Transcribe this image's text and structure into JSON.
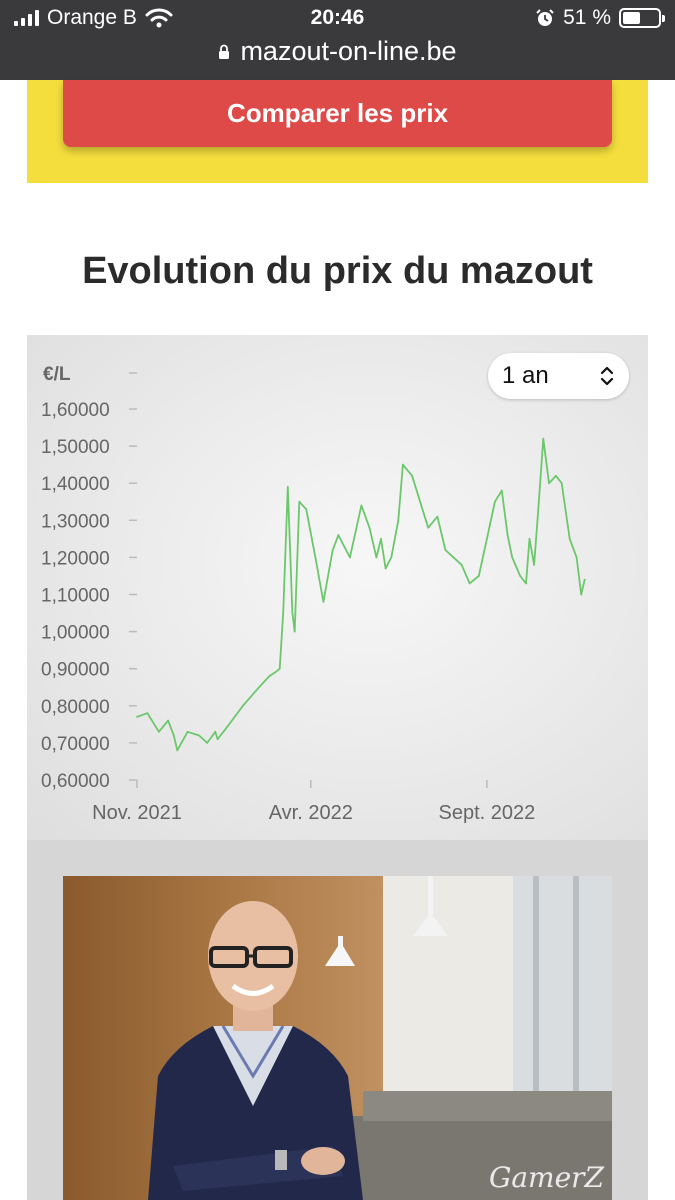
{
  "status_bar": {
    "carrier": "Orange B",
    "time": "20:46",
    "battery_percent": "51 %",
    "battery_level": 0.51,
    "icons": [
      "signal-icon",
      "wifi-icon",
      "alarm-icon",
      "battery-icon"
    ]
  },
  "browser": {
    "url": "mazout-on-line.be",
    "icon": "lock-icon"
  },
  "cta": {
    "label": "Comparer les prix"
  },
  "section": {
    "title": "Evolution du prix du mazout"
  },
  "period_select": {
    "value": "1 an",
    "icon": "up-down-chevron-icon"
  },
  "colors": {
    "accent_red": "#dd4a48",
    "band_yellow": "#f4de3d",
    "line_green": "#6cc76c"
  },
  "chart_data": {
    "type": "line",
    "ylabel": "€/L",
    "ylim": [
      0.6,
      1.6
    ],
    "yticks": [
      "1,60000",
      "1,50000",
      "1,40000",
      "1,30000",
      "1,20000",
      "1,10000",
      "1,00000",
      "0,90000",
      "0,80000",
      "0,70000",
      "0,60000"
    ],
    "xtick_labels": [
      "Nov. 2021",
      "Avr. 2022",
      "Sept. 2022"
    ],
    "xtick_dates": [
      "2021-11-01",
      "2022-04-01",
      "2022-09-01"
    ],
    "xlim": [
      "2021-11-01",
      "2022-11-27"
    ],
    "series": [
      {
        "x": [
          "2021-11-01",
          "2021-11-10",
          "2021-11-20",
          "2021-11-28",
          "2021-12-03",
          "2021-12-06",
          "2021-12-15",
          "2021-12-25",
          "2022-01-01",
          "2022-01-08",
          "2022-01-10",
          "2022-01-20",
          "2022-02-01",
          "2022-02-15",
          "2022-02-24",
          "2022-03-01",
          "2022-03-05",
          "2022-03-08",
          "2022-03-12",
          "2022-03-16",
          "2022-03-18",
          "2022-03-22",
          "2022-03-28",
          "2022-04-05",
          "2022-04-12",
          "2022-04-20",
          "2022-04-25",
          "2022-05-05",
          "2022-05-15",
          "2022-05-22",
          "2022-05-28",
          "2022-06-01",
          "2022-06-05",
          "2022-06-10",
          "2022-06-16",
          "2022-06-20",
          "2022-06-28",
          "2022-07-05",
          "2022-07-12",
          "2022-07-20",
          "2022-07-27",
          "2022-08-03",
          "2022-08-10",
          "2022-08-17",
          "2022-08-25",
          "2022-09-01",
          "2022-09-08",
          "2022-09-14",
          "2022-09-19",
          "2022-09-23",
          "2022-09-30",
          "2022-10-05",
          "2022-10-08",
          "2022-10-12",
          "2022-10-15",
          "2022-10-20",
          "2022-10-25",
          "2022-10-31",
          "2022-11-05",
          "2022-11-12",
          "2022-11-18",
          "2022-11-22",
          "2022-11-25"
        ],
        "y": [
          0.77,
          0.78,
          0.73,
          0.76,
          0.72,
          0.68,
          0.73,
          0.72,
          0.7,
          0.73,
          0.71,
          0.75,
          0.8,
          0.85,
          0.88,
          0.89,
          0.9,
          1.05,
          1.39,
          1.05,
          1.0,
          1.35,
          1.33,
          1.2,
          1.08,
          1.22,
          1.26,
          1.2,
          1.34,
          1.28,
          1.2,
          1.25,
          1.17,
          1.2,
          1.3,
          1.45,
          1.42,
          1.35,
          1.28,
          1.31,
          1.22,
          1.2,
          1.18,
          1.13,
          1.15,
          1.25,
          1.35,
          1.38,
          1.26,
          1.2,
          1.15,
          1.13,
          1.25,
          1.18,
          1.3,
          1.52,
          1.4,
          1.42,
          1.4,
          1.25,
          1.2,
          1.1,
          1.14
        ]
      }
    ]
  },
  "photo": {
    "watermark": "GamerZ"
  }
}
